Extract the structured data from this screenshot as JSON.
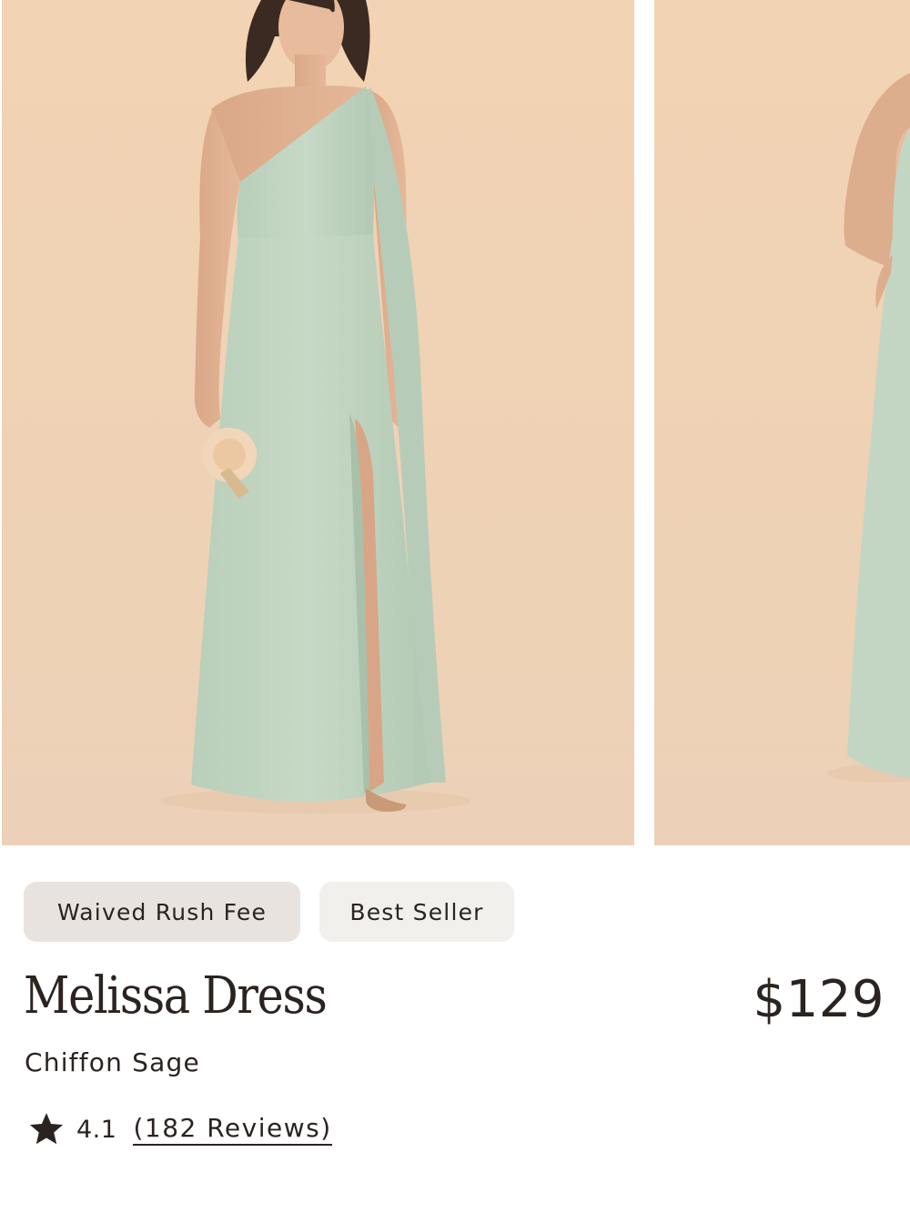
{
  "gallery": {
    "images": [
      {
        "name": "model-front-view"
      },
      {
        "name": "model-side-view"
      }
    ]
  },
  "badges": {
    "rush": "Waived Rush Fee",
    "best": "Best Seller"
  },
  "product": {
    "title": "Melissa Dress",
    "price": "$129",
    "variant": "Chiffon Sage",
    "rating": "4.1",
    "reviews": "(182 Reviews)"
  },
  "icons": {
    "rating": "star-icon"
  },
  "colors": {
    "background": "#ffffff",
    "photo_backdrop": "#efd2b5",
    "dress": "#c3d6c4",
    "text": "#2b2320",
    "badge_rush_bg": "#e9e3df",
    "badge_best_bg": "#f2f0ed"
  }
}
